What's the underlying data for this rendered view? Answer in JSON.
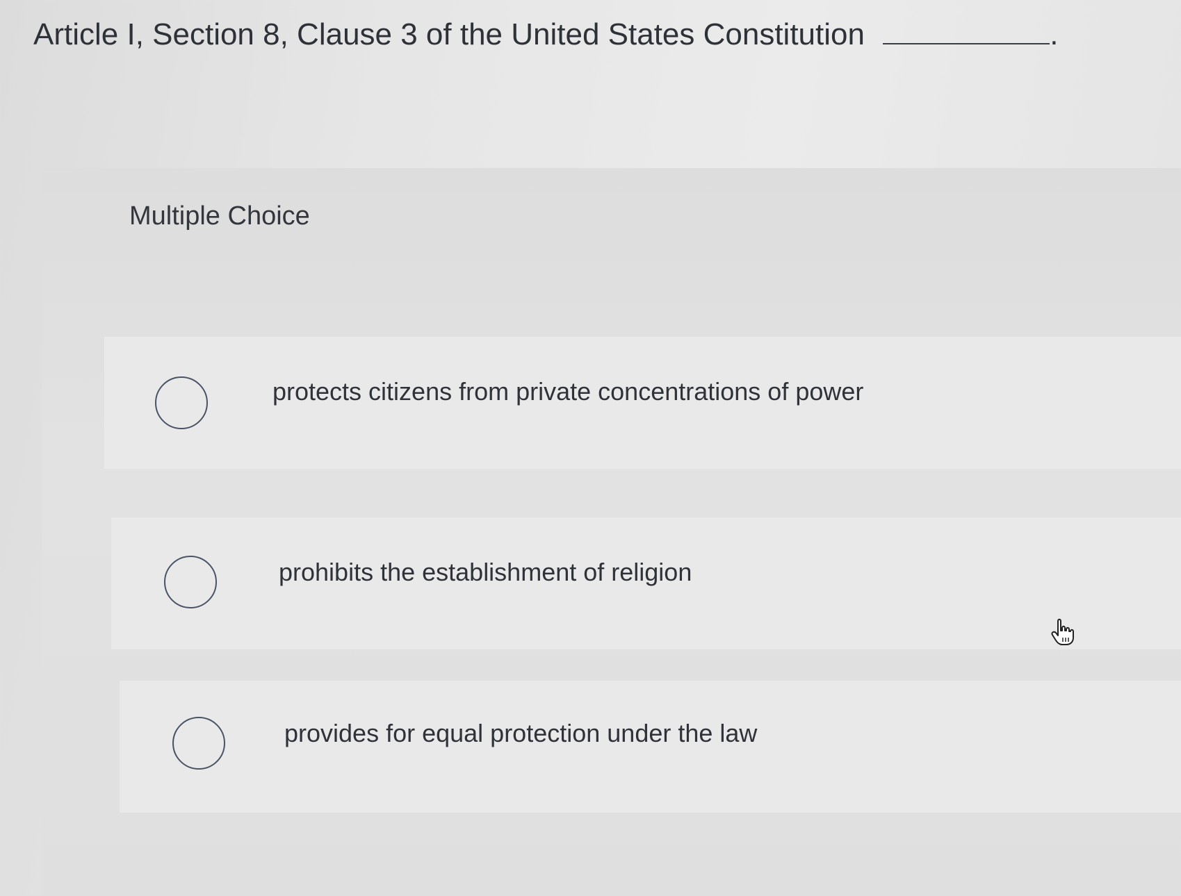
{
  "question": {
    "text": "Article I, Section 8, Clause 3 of the United States Constitution",
    "trailing": "."
  },
  "section_label": "Multiple Choice",
  "options": [
    {
      "label": "protects citizens from private concentrations of power",
      "selected": false
    },
    {
      "label": "prohibits the establishment of religion",
      "selected": false
    },
    {
      "label": "provides for equal protection under the law",
      "selected": false
    }
  ],
  "cursor_icon": "hand-pointer-icon",
  "colors": {
    "text": "#2e3138",
    "radio_border": "#4a5366",
    "option_bg": "#e9e9e9",
    "panel_bg": "#dfdfdf"
  }
}
